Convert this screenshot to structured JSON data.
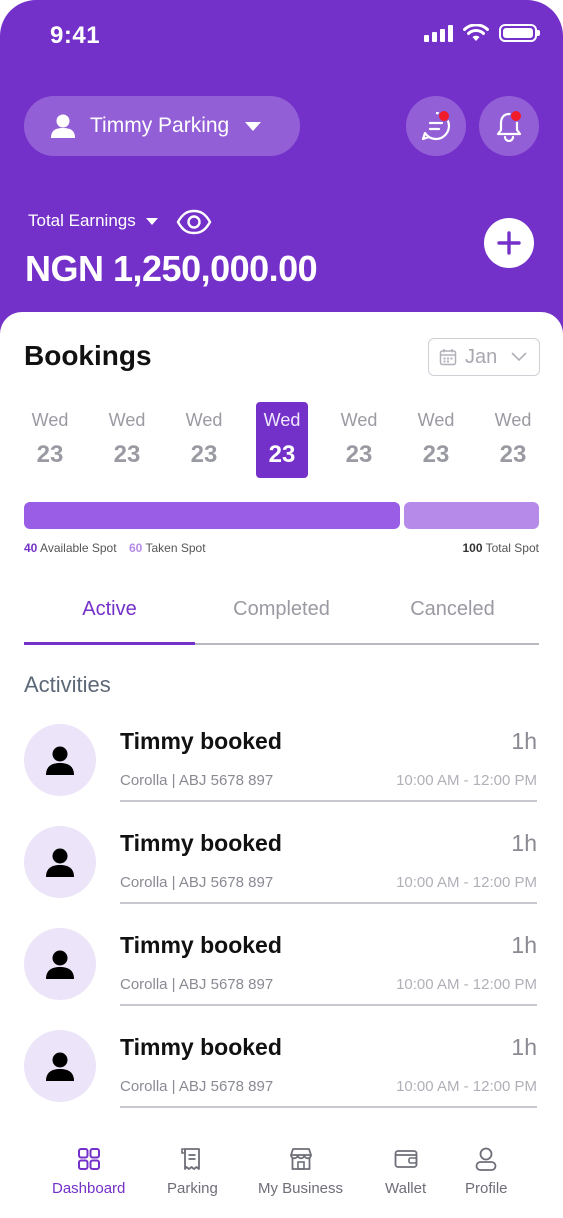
{
  "status_bar": {
    "time": "9:41"
  },
  "header": {
    "account_name": "Timmy Parking",
    "earnings_label": "Total Earnings",
    "earnings_amount": "NGN 1,250,000.00"
  },
  "bookings": {
    "title": "Bookings",
    "month": "Jan",
    "days": [
      {
        "name": "Wed",
        "num": "23",
        "selected": false
      },
      {
        "name": "Wed",
        "num": "23",
        "selected": false
      },
      {
        "name": "Wed",
        "num": "23",
        "selected": false
      },
      {
        "name": "Wed",
        "num": "23",
        "selected": true
      },
      {
        "name": "Wed",
        "num": "23",
        "selected": false
      },
      {
        "name": "Wed",
        "num": "23",
        "selected": false
      },
      {
        "name": "Wed",
        "num": "23",
        "selected": false
      }
    ],
    "spots": {
      "available_count": "40",
      "available_label": "Available Spot",
      "taken_count": "60",
      "taken_label": "Taken Spot",
      "total_count": "100",
      "total_label": "Total Spot",
      "bar_split_fraction": 0.73
    }
  },
  "tabs": [
    {
      "label": "Active",
      "active": true
    },
    {
      "label": "Completed",
      "active": false
    },
    {
      "label": "Canceled",
      "active": false
    }
  ],
  "activities": {
    "title": "Activities",
    "items": [
      {
        "title": "Timmy booked",
        "duration": "1h",
        "vehicle": "Corolla | ABJ 5678 897",
        "time": "10:00 AM - 12:00 PM"
      },
      {
        "title": "Timmy booked",
        "duration": "1h",
        "vehicle": "Corolla | ABJ 5678 897",
        "time": "10:00 AM - 12:00 PM"
      },
      {
        "title": "Timmy booked",
        "duration": "1h",
        "vehicle": "Corolla | ABJ 5678 897",
        "time": "10:00 AM - 12:00 PM"
      },
      {
        "title": "Timmy booked",
        "duration": "1h",
        "vehicle": "Corolla | ABJ 5678 897",
        "time": "10:00 AM - 12:00 PM"
      }
    ]
  },
  "bottom_nav": [
    {
      "label": "Dashboard",
      "icon": "grid-icon",
      "active": true
    },
    {
      "label": "Parking",
      "icon": "receipt-icon",
      "active": false
    },
    {
      "label": "My Business",
      "icon": "store-icon",
      "active": false
    },
    {
      "label": "Wallet",
      "icon": "wallet-icon",
      "active": false
    },
    {
      "label": "Profile",
      "icon": "user-icon",
      "active": false
    }
  ],
  "colors": {
    "primary": "#7431c9",
    "available_bar": "#9a5de6",
    "taken_bar": "#b58ae9",
    "notification_dot": "#f01c2c"
  }
}
